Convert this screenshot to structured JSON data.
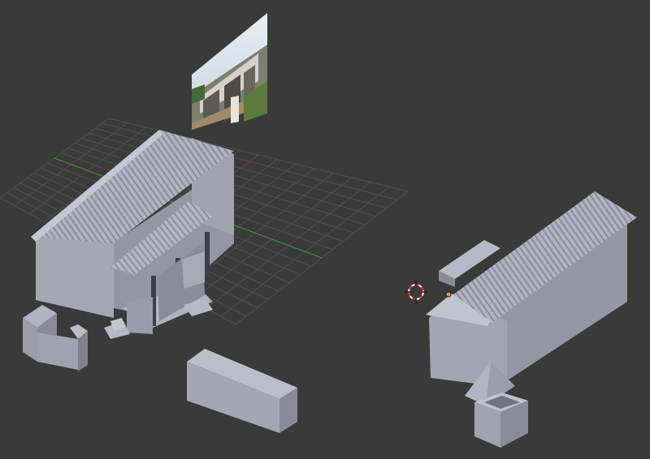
{
  "viewport": {
    "background": "#3a3a3a",
    "grid_color": "#4f4f4f",
    "x_axis_color": "#7a3a3a",
    "y_axis_color": "#3f8f3f"
  },
  "materials": {
    "clay_light": "#a9a9b6",
    "clay_mid": "#8e8e9c",
    "clay_dark": "#6e6e7c",
    "roof_light": "#b7b7c4",
    "roof_dark": "#8a8a98"
  },
  "cursor": {
    "icon": "3d-cursor-icon"
  },
  "objects": [
    {
      "name": "reference-photo-plane"
    },
    {
      "name": "house-main-left"
    },
    {
      "name": "wall-block-left"
    },
    {
      "name": "shed-box"
    },
    {
      "name": "house-right"
    },
    {
      "name": "well-tower"
    }
  ]
}
